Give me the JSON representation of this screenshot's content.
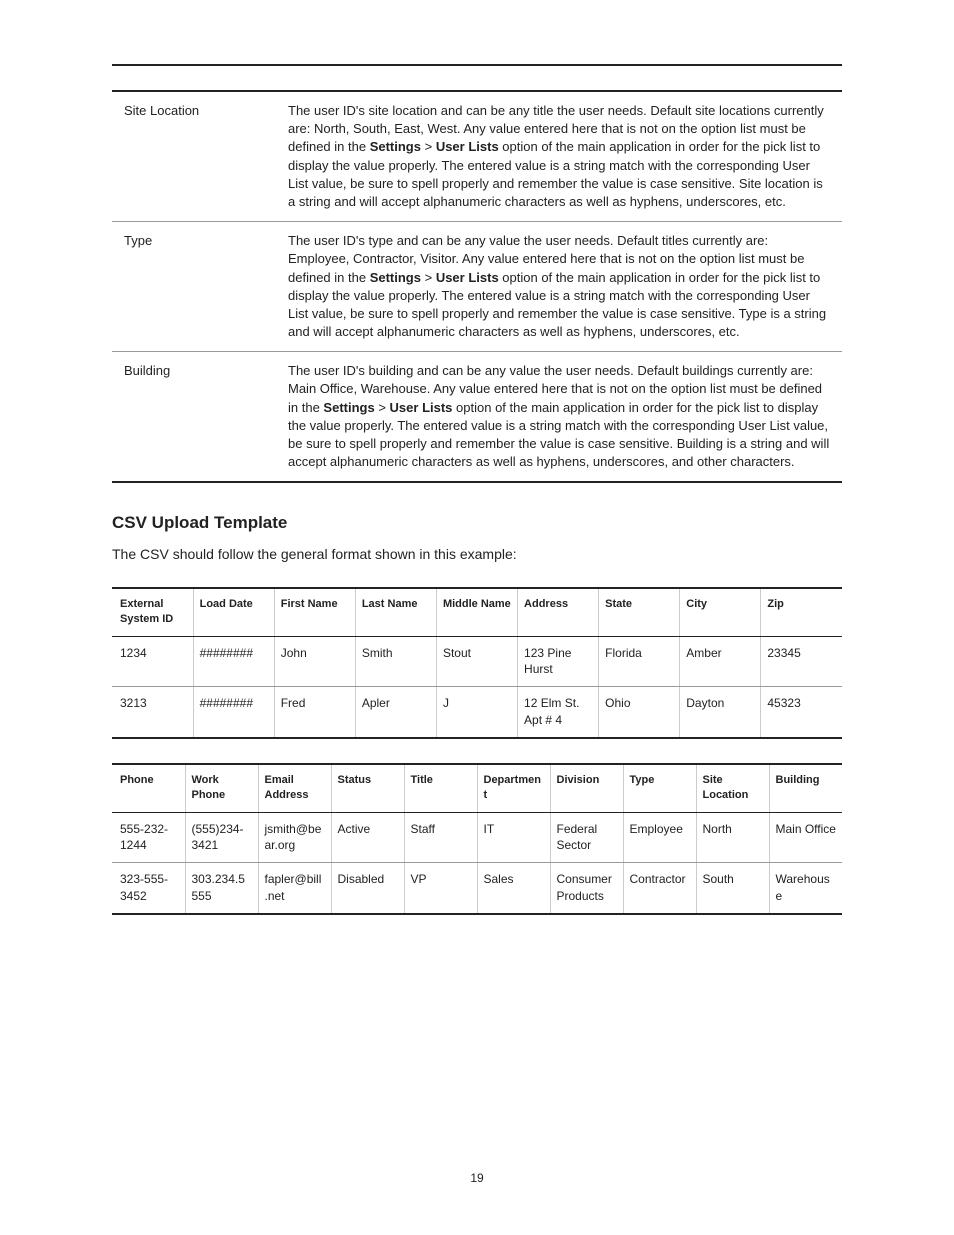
{
  "page_number": "19",
  "definitions": [
    {
      "term": "Site Location",
      "pre": "The user ID's site location and can be any title the user needs. Default site locations currently are: North, South, East, West. Any value entered here that is not on the option list must be defined in the ",
      "bold1": "Settings",
      "mid": " > ",
      "bold2": "User Lists",
      "post": " option of the main application in order for the pick list to display the value properly. The entered value is a string match with the corresponding User List value, be sure to spell properly and remember the value is case sensitive. Site location is a string and will accept alphanumeric characters as well as hyphens, underscores, etc."
    },
    {
      "term": "Type",
      "pre": "The user ID's type and can be any value the user needs. Default titles currently are: Employee, Contractor, Visitor. Any value entered here that is not on the option list must be defined in the ",
      "bold1": "Settings",
      "mid": " > ",
      "bold2": "User Lists",
      "post": " option of the main application in order for the pick list to display the value properly. The entered value is a string match with the corresponding User List value, be sure to spell properly and remember the value is case sensitive. Type is a string and will accept alphanumeric characters as well as hyphens, underscores, etc."
    },
    {
      "term": "Building",
      "pre": "The user ID's building and can be any value the user needs. Default buildings currently are: Main Office, Warehouse. Any value entered here that is not on the option list must be defined in the ",
      "bold1": "Settings",
      "mid": " > ",
      "bold2": "User Lists",
      "post": " option of the main application in order for the pick list to display the value properly. The entered value is a string match with the corresponding User List value, be sure to spell properly and remember the value is case sensitive. Building is a string and will accept alphanumeric characters as well as hyphens, underscores, and other characters."
    }
  ],
  "section_title": "CSV Upload Template",
  "intro": "The CSV should follow the general format shown in this example:",
  "table1": {
    "headers": [
      "External System ID",
      "Load Date",
      "First Name",
      "Last Name",
      "Middle Name",
      "Address",
      "State",
      "City",
      "Zip"
    ],
    "rows": [
      [
        "1234",
        "########",
        "John",
        "Smith",
        "Stout",
        "123 Pine Hurst",
        "Florida",
        "Amber",
        "23345"
      ],
      [
        "3213",
        "########",
        "Fred",
        "Apler",
        "J",
        "12 Elm St. Apt # 4",
        "Ohio",
        "Dayton",
        "45323"
      ]
    ]
  },
  "table2": {
    "headers": [
      "Phone",
      "Work Phone",
      "Email Address",
      "Status",
      "Title",
      "Department",
      "Division",
      "Type",
      "Site Location",
      "Building"
    ],
    "rows": [
      [
        "555-232-1244",
        "(555)234-3421",
        "jsmith@bear.org",
        "Active",
        "Staff",
        "IT",
        "Federal Sector",
        "Employee",
        "North",
        "Main Office"
      ],
      [
        "323-555-3452",
        "303.234.5555",
        "fapler@bill.net",
        "Disabled",
        "VP",
        "Sales",
        "Consumer Products",
        "Contractor",
        "South",
        "Warehouse"
      ]
    ]
  }
}
